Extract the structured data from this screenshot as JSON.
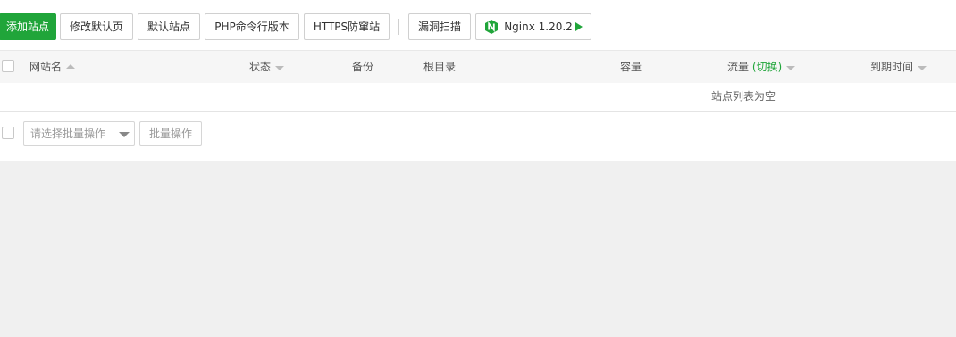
{
  "toolbar": {
    "add_site": "添加站点",
    "edit_default_page": "修改默认页",
    "default_site": "默认站点",
    "php_cli_version": "PHP命令行版本",
    "https_anti_intrusion": "HTTPS防窜站",
    "vuln_scan": "漏洞扫描",
    "nginx_version": "Nginx 1.20.2",
    "nginx_icon": "nginx-logo-icon",
    "run_icon": "play-icon"
  },
  "table": {
    "columns": {
      "site_name": "网站名",
      "status": "状态",
      "backup": "备份",
      "root_dir": "根目录",
      "capacity": "容量",
      "traffic": "流量",
      "traffic_toggle": "(切换)",
      "expiry": "到期时间"
    },
    "empty_message": "站点列表为空"
  },
  "batch": {
    "select_placeholder": "请选择批量操作",
    "action_button": "批量操作"
  },
  "colors": {
    "accent": "#20a53a",
    "panel_bg": "#ffffff",
    "page_bg": "#f0f0f0",
    "header_bg": "#f6f6f6"
  }
}
